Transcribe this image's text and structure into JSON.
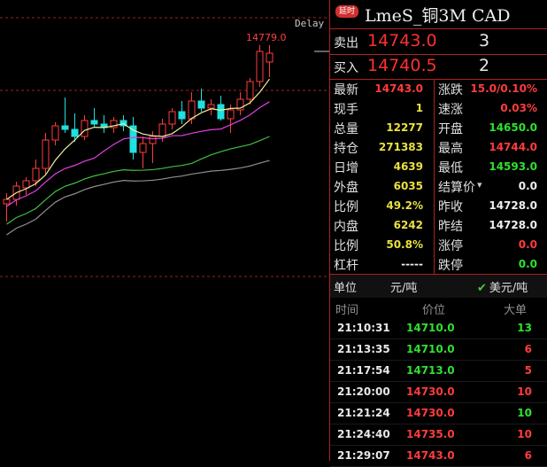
{
  "chart": {
    "delay_label": "Delay",
    "max_label": "14779.0"
  },
  "chart_data": {
    "type": "candlestick",
    "candles": [
      {
        "o": 14600,
        "h": 14612,
        "l": 14580,
        "c": 14605,
        "up": true
      },
      {
        "o": 14605,
        "h": 14625,
        "l": 14598,
        "c": 14620,
        "up": true
      },
      {
        "o": 14618,
        "h": 14630,
        "l": 14610,
        "c": 14626,
        "up": true
      },
      {
        "o": 14626,
        "h": 14650,
        "l": 14620,
        "c": 14640,
        "up": true
      },
      {
        "o": 14640,
        "h": 14680,
        "l": 14632,
        "c": 14672,
        "up": true
      },
      {
        "o": 14672,
        "h": 14692,
        "l": 14666,
        "c": 14688,
        "up": true
      },
      {
        "o": 14688,
        "h": 14720,
        "l": 14680,
        "c": 14684,
        "up": false
      },
      {
        "o": 14684,
        "h": 14702,
        "l": 14670,
        "c": 14676,
        "up": false
      },
      {
        "o": 14676,
        "h": 14700,
        "l": 14672,
        "c": 14694,
        "up": true
      },
      {
        "o": 14694,
        "h": 14708,
        "l": 14686,
        "c": 14690,
        "up": true
      },
      {
        "o": 14690,
        "h": 14700,
        "l": 14680,
        "c": 14686,
        "up": true
      },
      {
        "o": 14686,
        "h": 14698,
        "l": 14680,
        "c": 14694,
        "up": true
      },
      {
        "o": 14694,
        "h": 14700,
        "l": 14682,
        "c": 14688,
        "up": true
      },
      {
        "o": 14688,
        "h": 14698,
        "l": 14650,
        "c": 14658,
        "up": false
      },
      {
        "o": 14658,
        "h": 14676,
        "l": 14640,
        "c": 14668,
        "up": true
      },
      {
        "o": 14668,
        "h": 14682,
        "l": 14646,
        "c": 14676,
        "up": true
      },
      {
        "o": 14676,
        "h": 14696,
        "l": 14670,
        "c": 14690,
        "up": true
      },
      {
        "o": 14690,
        "h": 14708,
        "l": 14684,
        "c": 14704,
        "up": true
      },
      {
        "o": 14704,
        "h": 14716,
        "l": 14690,
        "c": 14696,
        "up": false
      },
      {
        "o": 14696,
        "h": 14726,
        "l": 14690,
        "c": 14716,
        "up": true
      },
      {
        "o": 14716,
        "h": 14730,
        "l": 14704,
        "c": 14708,
        "up": true
      },
      {
        "o": 14708,
        "h": 14718,
        "l": 14700,
        "c": 14712,
        "up": true
      },
      {
        "o": 14712,
        "h": 14722,
        "l": 14694,
        "c": 14696,
        "up": false
      },
      {
        "o": 14696,
        "h": 14712,
        "l": 14680,
        "c": 14706,
        "up": true
      },
      {
        "o": 14706,
        "h": 14726,
        "l": 14700,
        "c": 14718,
        "up": true
      },
      {
        "o": 14718,
        "h": 14742,
        "l": 14712,
        "c": 14738,
        "up": true
      },
      {
        "o": 14738,
        "h": 14779,
        "l": 14732,
        "c": 14772,
        "up": true
      },
      {
        "o": 14760,
        "h": 14779,
        "l": 14743,
        "c": 14770,
        "up": true
      }
    ],
    "ylim": [
      14560,
      14790
    ],
    "reference_line": 14728
  },
  "panel": {
    "badge": "延时",
    "title": "LmeS_铜3M CAD",
    "sell_label": "卖出",
    "sell_price": "14743.0",
    "sell_vol": "3",
    "buy_label": "买入",
    "buy_price": "14740.5",
    "buy_vol": "2",
    "left_stats": [
      {
        "k": "最新",
        "v": "14743.0",
        "c": "red"
      },
      {
        "k": "现手",
        "v": "1",
        "c": "yellow"
      },
      {
        "k": "总量",
        "v": "12277",
        "c": "yellow"
      },
      {
        "k": "持仓",
        "v": "271383",
        "c": "yellow"
      },
      {
        "k": "日增",
        "v": "4639",
        "c": "yellow"
      },
      {
        "k": "外盘",
        "v": "6035",
        "c": "yellow"
      },
      {
        "k": "比例",
        "v": "49.2%",
        "c": "yellow"
      },
      {
        "k": "内盘",
        "v": "6242",
        "c": "yellow"
      },
      {
        "k": "比例",
        "v": "50.8%",
        "c": "yellow"
      },
      {
        "k": "杠杆",
        "v": "-----",
        "c": "white"
      }
    ],
    "right_stats": [
      {
        "k": "涨跌",
        "v": "15.0/0.10%",
        "c": "red"
      },
      {
        "k": "速涨",
        "v": "0.03%",
        "c": "red"
      },
      {
        "k": "开盘",
        "v": "14650.0",
        "c": "green"
      },
      {
        "k": "最高",
        "v": "14744.0",
        "c": "red"
      },
      {
        "k": "最低",
        "v": "14593.0",
        "c": "green"
      },
      {
        "k": "结算价",
        "v": "0.0",
        "c": "white"
      },
      {
        "k": "昨收",
        "v": "14728.0",
        "c": "white"
      },
      {
        "k": "昨结",
        "v": "14728.0",
        "c": "white"
      },
      {
        "k": "涨停",
        "v": "0.0",
        "c": "red"
      },
      {
        "k": "跌停",
        "v": "0.0",
        "c": "green"
      }
    ],
    "unit_label": "单位",
    "unit_cny": "元/吨",
    "unit_usd": "美元/吨",
    "ticks_header": {
      "time": "时间",
      "price": "价位",
      "vol": "大单"
    },
    "ticks": [
      {
        "time": "21:10:31",
        "price": "14710.0",
        "pc": "green",
        "vol": "13",
        "vc": "green"
      },
      {
        "time": "21:13:35",
        "price": "14710.0",
        "pc": "green",
        "vol": "6",
        "vc": "red"
      },
      {
        "time": "21:17:54",
        "price": "14713.0",
        "pc": "green",
        "vol": "5",
        "vc": "red"
      },
      {
        "time": "21:20:00",
        "price": "14730.0",
        "pc": "red",
        "vol": "10",
        "vc": "red"
      },
      {
        "time": "21:21:24",
        "price": "14730.0",
        "pc": "red",
        "vol": "10",
        "vc": "green"
      },
      {
        "time": "21:24:40",
        "price": "14735.0",
        "pc": "red",
        "vol": "10",
        "vc": "red"
      },
      {
        "time": "21:29:07",
        "price": "14743.0",
        "pc": "red",
        "vol": "6",
        "vc": "red"
      }
    ]
  }
}
